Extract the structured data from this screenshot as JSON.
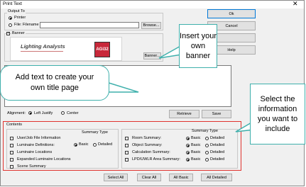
{
  "window": {
    "title": "Print Text",
    "close_glyph": "✕"
  },
  "output_to": {
    "label": "Output To",
    "printer_label": "Printer",
    "file_label": "File: Filename",
    "browse_label": "Browse..."
  },
  "banner": {
    "checkbox_label": "Banner",
    "logo_text": "Lighting Analysts",
    "logo_badge": "AGi32",
    "button_label": "Banner..."
  },
  "right_buttons": {
    "ok": "Ok",
    "cancel": "Cancel",
    "third": "",
    "help": "Help"
  },
  "alignment": {
    "label": "Alignment:",
    "left_label": "Left Justify",
    "center_label": "Center",
    "retrieve_label": "Retrieve",
    "save_label": "Save"
  },
  "contents": {
    "label": "Contents",
    "summary_type_header": "Summary Type",
    "left_items": [
      "User/Job File Information",
      "Luminaire Definitions:",
      "Luminaire Locations",
      "Expanded Luminaire Locations",
      "Scene Summary"
    ],
    "right_items": [
      "Room Summary:",
      "Object Summary:",
      "Calculation Summary:",
      "LPD/UWLR Area Summary:"
    ],
    "basic_label": "Basic",
    "detailed_label": "Detailed"
  },
  "bottom_buttons": {
    "select_all": "Select All",
    "clear_all": "Clear All",
    "all_basic": "All Basic",
    "all_detailed": "All Detailed"
  },
  "callouts": {
    "banner": "Insert your own banner",
    "title_page": "Add text to create your own title page",
    "contents": "Select the information you want to include"
  },
  "colors": {
    "accent": "#3fb0ac",
    "highlight": "#e0342f"
  }
}
